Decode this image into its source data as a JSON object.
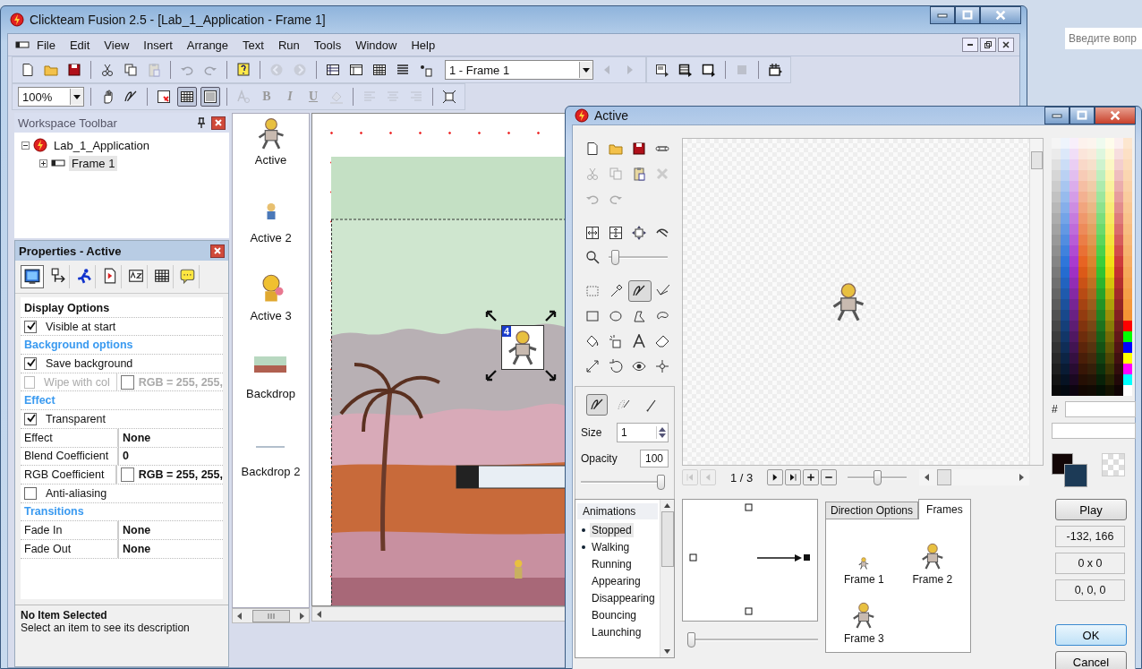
{
  "window": {
    "title": "Clickteam Fusion 2.5 - [Lab_1_Application - Frame 1]"
  },
  "menu": [
    "File",
    "Edit",
    "View",
    "Insert",
    "Arrange",
    "Text",
    "Run",
    "Tools",
    "Window",
    "Help"
  ],
  "toolbar_main": [
    {
      "disabled": false
    },
    {
      "disabled": false
    },
    {
      "disabled": false
    },
    {
      "disabled": false
    },
    {
      "disabled": false
    },
    {
      "disabled": true
    },
    {
      "disabled": true
    },
    {
      "disabled": true
    },
    {
      "disabled": false
    },
    {
      "disabled": true
    },
    {
      "disabled": true
    },
    {
      "disabled": false
    },
    {
      "disabled": false
    },
    {
      "disabled": false
    },
    {
      "disabled": false
    },
    {
      "disabled": false
    }
  ],
  "frame_select": {
    "value": "1 - Frame 1"
  },
  "frame_nav": [
    {
      "disabled": true
    },
    {
      "disabled": true
    }
  ],
  "toolbar_run": [
    {
      "disabled": false
    },
    {
      "disabled": false
    },
    {
      "disabled": false
    },
    {
      "disabled": true
    },
    {
      "disabled": false
    }
  ],
  "zoom_select": {
    "value": "100%"
  },
  "view_toggles": [
    {
      "on": false
    },
    {
      "on": true
    },
    {
      "on": true
    }
  ],
  "format_buttons": [
    {
      "label": "B",
      "disabled": true
    },
    {
      "label": "I",
      "disabled": true
    },
    {
      "label": "U",
      "disabled": true
    }
  ],
  "help_search": {
    "placeholder": "Введите вопр"
  },
  "workspace": {
    "title": "Workspace Toolbar",
    "tree": [
      {
        "label": "Lab_1_Application",
        "expanded": true,
        "selected": false,
        "children": [
          {
            "label": "Frame 1",
            "expanded": false,
            "selected": true
          }
        ]
      }
    ]
  },
  "properties": {
    "title": "Properties - Active",
    "tabs": [
      {
        "selected": true
      },
      {
        "selected": false
      },
      {
        "selected": false
      },
      {
        "selected": false
      },
      {
        "selected": false
      },
      {
        "selected": false
      },
      {
        "selected": false
      }
    ],
    "rows": [
      {
        "kind": "header",
        "label": "Display Options"
      },
      {
        "kind": "check",
        "label": "Visible at start",
        "checked": true,
        "disabled": false
      },
      {
        "kind": "section",
        "label": "Background options"
      },
      {
        "kind": "check",
        "label": "Save background",
        "checked": true,
        "disabled": false
      },
      {
        "kind": "check_color",
        "label": "Wipe with col",
        "checked": false,
        "disabled": true,
        "value": "RGB = 255, 255,"
      },
      {
        "kind": "section",
        "label": "Effect"
      },
      {
        "kind": "check",
        "label": "Transparent",
        "checked": true,
        "disabled": false
      },
      {
        "kind": "value",
        "label": "Effect",
        "value": "None"
      },
      {
        "kind": "value",
        "label": "Blend Coefficient",
        "value": "0"
      },
      {
        "kind": "color",
        "label": "RGB Coefficient",
        "value": "RGB = 255, 255,"
      },
      {
        "kind": "check",
        "label": "Anti-aliasing",
        "checked": false,
        "disabled": false
      },
      {
        "kind": "section",
        "label": "Transitions"
      },
      {
        "kind": "value",
        "label": "Fade In",
        "value": "None"
      },
      {
        "kind": "value",
        "label": "Fade Out",
        "value": "None"
      }
    ],
    "description": {
      "title": "No Item Selected",
      "text": "Select an item to see its description"
    }
  },
  "objects": [
    {
      "kind": "active",
      "label": "Active"
    },
    {
      "kind": "active",
      "label": "Active 2"
    },
    {
      "kind": "active",
      "label": "Active 3"
    },
    {
      "kind": "backdrop",
      "label": "Backdrop"
    },
    {
      "kind": "backdrop",
      "label": "Backdrop 2"
    }
  ],
  "frame_editor": {
    "selection_badge": "4"
  },
  "editor": {
    "title": "Active",
    "actions": [
      {
        "disabled": false
      },
      {
        "disabled": false
      },
      {
        "disabled": false
      },
      {
        "disabled": false
      },
      {
        "disabled": true
      },
      {
        "disabled": true
      },
      {
        "disabled": false
      },
      {
        "disabled": true
      },
      {
        "disabled": true
      },
      {
        "disabled": true
      }
    ],
    "zoom_slider": {
      "level": 0.05
    },
    "tools": [
      {
        "selected": false
      },
      {
        "selected": false
      },
      {
        "selected": true
      },
      {
        "selected": false
      },
      {
        "selected": false
      },
      {
        "selected": false
      },
      {
        "selected": false
      },
      {
        "selected": false
      },
      {
        "selected": false
      },
      {
        "selected": false
      },
      {
        "selected": false
      },
      {
        "selected": false
      },
      {
        "selected": false
      },
      {
        "selected": false
      },
      {
        "selected": false
      },
      {
        "selected": false
      }
    ],
    "pen_modes": [
      {
        "selected": true
      },
      {
        "selected": false
      },
      {
        "selected": false
      }
    ],
    "size_label": "Size",
    "size": "1",
    "opacity_label": "Opacity",
    "opacity": "100",
    "opacity_slider": {
      "level": 1
    },
    "frame_counter": "1 / 3",
    "preview_zoom": {
      "level": 0.5
    },
    "animations": {
      "title": "Animations",
      "items": [
        {
          "label": "Stopped",
          "has_frames": true,
          "selected": true
        },
        {
          "label": "Walking",
          "has_frames": true,
          "selected": false
        },
        {
          "label": "Running",
          "has_frames": false,
          "selected": false
        },
        {
          "label": "Appearing",
          "has_frames": false,
          "selected": false
        },
        {
          "label": "Disappearing",
          "has_frames": false,
          "selected": false
        },
        {
          "label": "Bouncing",
          "has_frames": false,
          "selected": false
        },
        {
          "label": "Launching",
          "has_frames": false,
          "selected": false
        }
      ]
    },
    "speed_slider": {
      "level": 0
    },
    "tabs": [
      {
        "label": "Direction Options",
        "selected": false
      },
      {
        "label": "Frames",
        "selected": true
      }
    ],
    "frames": [
      {
        "label": "Frame 1"
      },
      {
        "label": "Frame 2"
      },
      {
        "label": "Frame 3"
      }
    ],
    "hex_label": "#",
    "play": "Play",
    "readouts": [
      "-132, 166",
      "0 x 0",
      "0, 0, 0"
    ],
    "ok": "OK",
    "cancel": "Cancel"
  }
}
